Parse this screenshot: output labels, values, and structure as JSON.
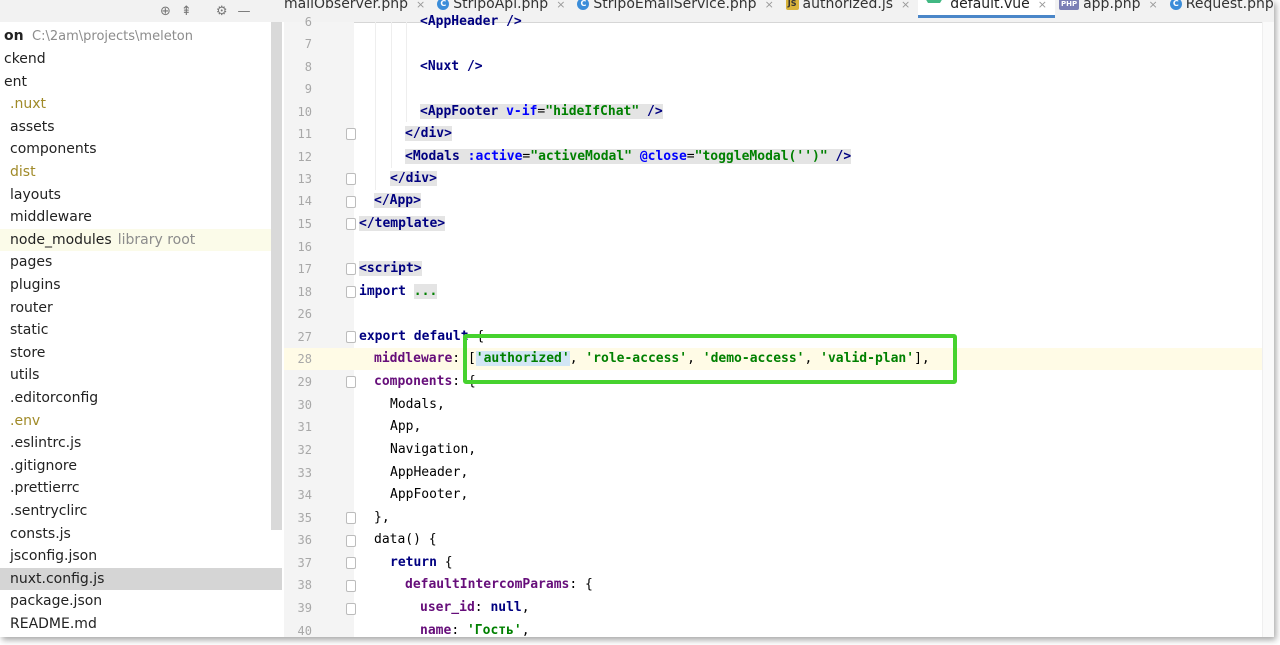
{
  "tabs": [
    {
      "label": "mailObserver.php",
      "icon": "php-class-icon",
      "badge": "C"
    },
    {
      "label": "StripoApi.php",
      "icon": "php-class-icon",
      "badge": "C"
    },
    {
      "label": "StripoEmailService.php",
      "icon": "php-class-icon",
      "badge": "C"
    },
    {
      "label": "authorized.js",
      "icon": "js-file-icon",
      "badge": "JS"
    },
    {
      "label": "default.vue",
      "icon": "vue-file-icon",
      "badge": ""
    },
    {
      "label": "app.php",
      "icon": "php-file-icon",
      "badge": "PHP"
    },
    {
      "label": "Request.php",
      "icon": "php-class-icon",
      "badge": "C"
    }
  ],
  "tab_close": "×",
  "project": {
    "root_name": "on",
    "root_path": "C:\\2am\\projects\\meleton",
    "items": [
      {
        "label": "ckend",
        "type": "plain"
      },
      {
        "label": "ent",
        "type": "plain"
      },
      {
        "label": ".nuxt",
        "type": "excluded"
      },
      {
        "label": "assets",
        "type": "plain"
      },
      {
        "label": "components",
        "type": "plain"
      },
      {
        "label": "dist",
        "type": "excluded"
      },
      {
        "label": "layouts",
        "type": "plain"
      },
      {
        "label": "middleware",
        "type": "plain"
      },
      {
        "label": "node_modules",
        "type": "library",
        "hint": "library root"
      },
      {
        "label": "pages",
        "type": "plain"
      },
      {
        "label": "plugins",
        "type": "plain"
      },
      {
        "label": "router",
        "type": "plain"
      },
      {
        "label": "static",
        "type": "plain"
      },
      {
        "label": "store",
        "type": "plain"
      },
      {
        "label": "utils",
        "type": "plain"
      },
      {
        "label": ".editorconfig",
        "type": "plain"
      },
      {
        "label": ".env",
        "type": "excluded"
      },
      {
        "label": ".eslintrc.js",
        "type": "plain"
      },
      {
        "label": ".gitignore",
        "type": "plain"
      },
      {
        "label": ".prettierrc",
        "type": "plain"
      },
      {
        "label": ".sentryclirc",
        "type": "plain"
      },
      {
        "label": "consts.js",
        "type": "plain"
      },
      {
        "label": "jsconfig.json",
        "type": "plain"
      },
      {
        "label": "nuxt.config.js",
        "type": "selected"
      },
      {
        "label": "package.json",
        "type": "plain"
      },
      {
        "label": "README.md",
        "type": "plain"
      }
    ]
  },
  "line_numbers": [
    "6",
    "7",
    "8",
    "9",
    "10",
    "11",
    "12",
    "13",
    "14",
    "15",
    "16",
    "17",
    "18",
    "26",
    "27",
    "28",
    "29",
    "30",
    "31",
    "32",
    "33",
    "34",
    "35",
    "36",
    "37",
    "38",
    "39",
    "40"
  ],
  "code": {
    "l6": "<AppHeader />",
    "l8": "<Nuxt />",
    "l10_tag": "<AppFooter",
    "l10_attr": "v-if",
    "l10_eq": "=",
    "l10_val": "\"hideIfChat\"",
    "l10_end": " />",
    "l11": "</div>",
    "l12_tag": "<Modals",
    "l12_attr1": ":active",
    "l12_val1": "\"activeModal\"",
    "l12_attr2": "@close",
    "l12_val2": "\"toggleModal('')\"",
    "l12_end": " />",
    "l13": "</div>",
    "l14": "</App>",
    "l15": "</template>",
    "l17": "<script>",
    "l18_kw": "import",
    "l18_dots": "...",
    "l27_kw": "export default",
    "l27_brace": " {",
    "l28_prop": "middleware",
    "l28_colon": ": ",
    "l28_open": "[",
    "l28_s1": "'authorized'",
    "l28_s2": "'role-access'",
    "l28_s3": "'demo-access'",
    "l28_s4": "'valid-plan'",
    "l28_close": "],",
    "l28_sep": ", ",
    "l29_prop": "components",
    "l29_rest": ": {",
    "l30": "Modals,",
    "l31": "App,",
    "l32": "Navigation,",
    "l33": "AppHeader,",
    "l34": "AppFooter,",
    "l35": "},",
    "l36": "data() {",
    "l37_kw": "return",
    "l37_rest": " {",
    "l38_prop": "defaultIntercomParams",
    "l38_rest": ": {",
    "l39_prop": "user_id",
    "l39_colon": ": ",
    "l39_kw": "null",
    "l39_comma": ",",
    "l40_prop": "name",
    "l40_colon": ": ",
    "l40_str": "'Гость'",
    "l40_comma": ","
  },
  "colors": {
    "callout": "#46d22e",
    "active_tab_underline": "#4a86c8"
  }
}
